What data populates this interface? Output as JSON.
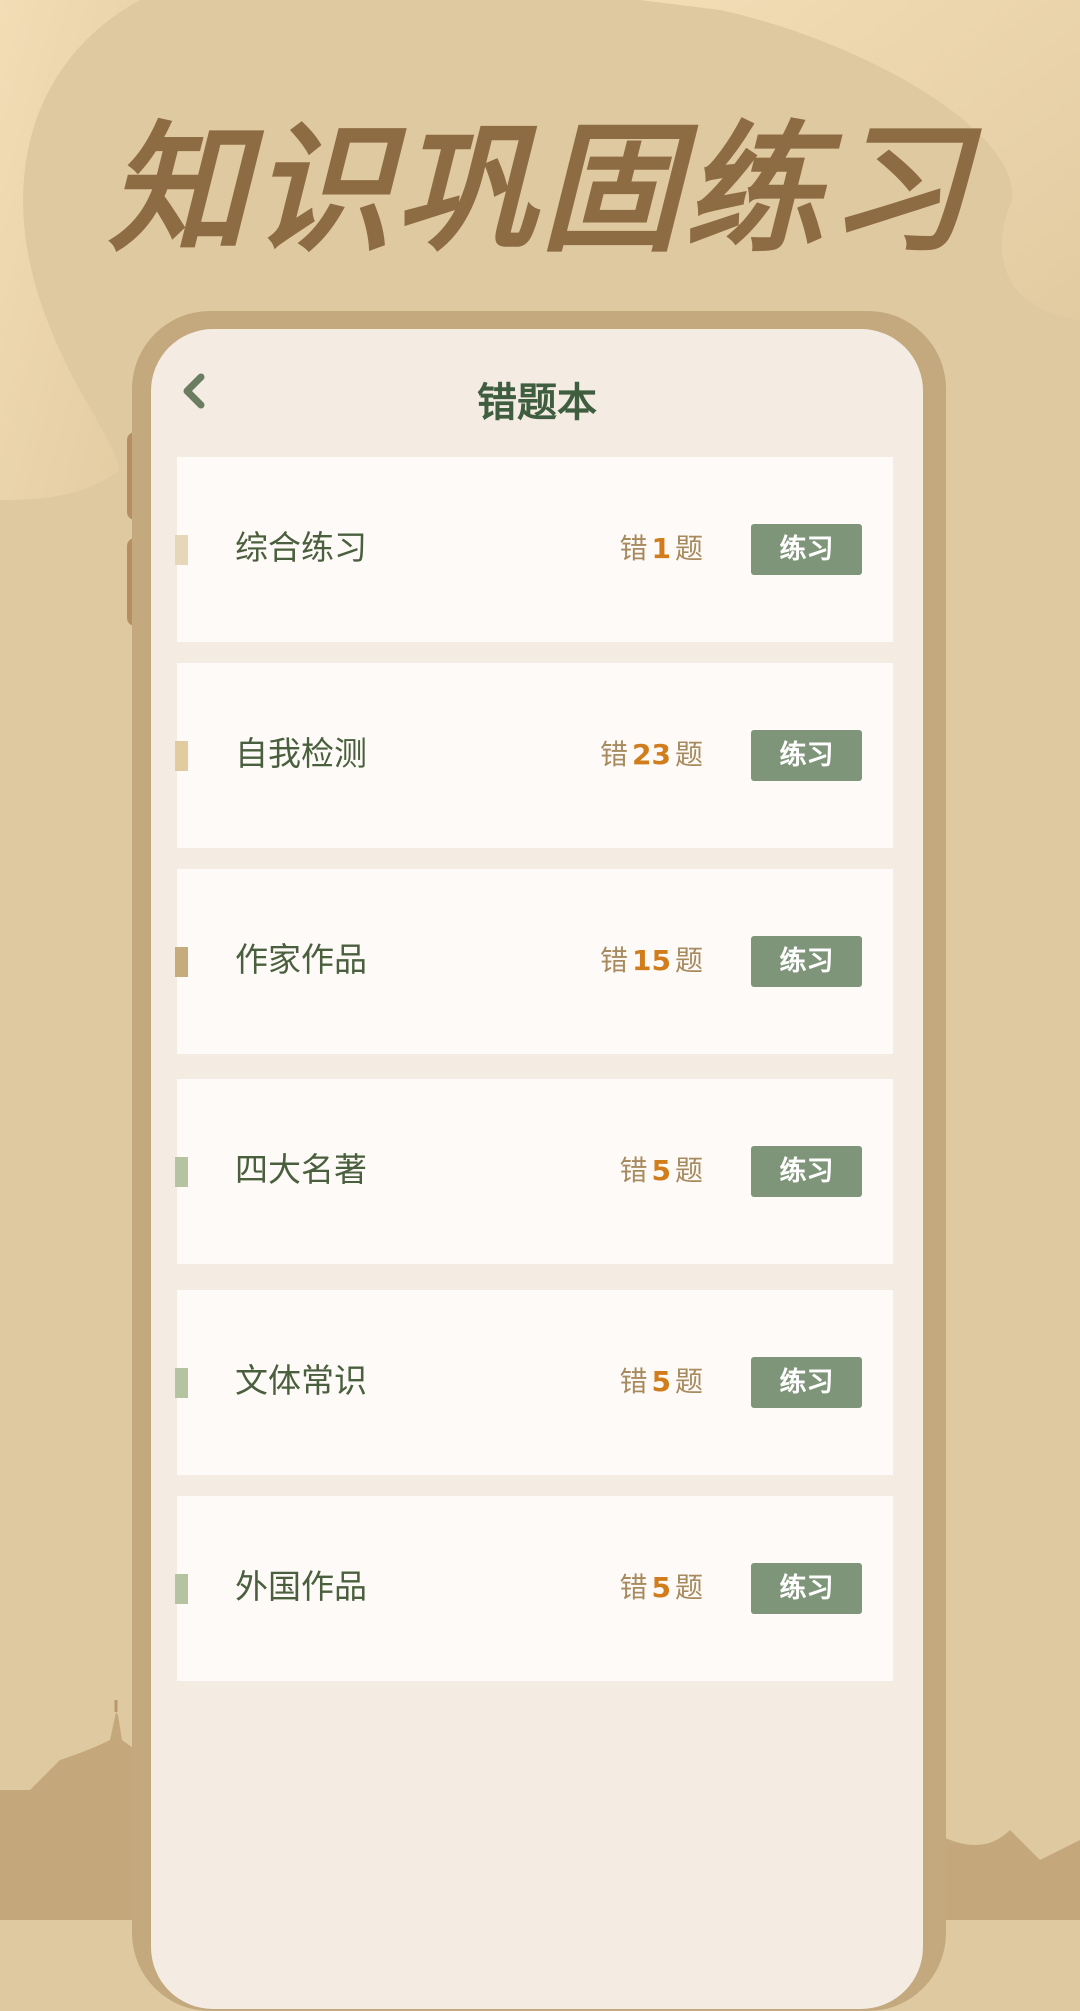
{
  "hero": {
    "title": "知识巩固练习"
  },
  "screen": {
    "title": "错题本",
    "back_icon": "chevron-left-icon"
  },
  "list": [
    {
      "name": "综合练习",
      "prefix": "错",
      "count": "1",
      "suffix": "题",
      "button": "练习",
      "accent": "#e6d7b8"
    },
    {
      "name": "自我检测",
      "prefix": "错",
      "count": "23",
      "suffix": "题",
      "button": "练习",
      "accent": "#e0cc9f"
    },
    {
      "name": "作家作品",
      "prefix": "错",
      "count": "15",
      "suffix": "题",
      "button": "练习",
      "accent": "#c6ab7d"
    },
    {
      "name": "四大名著",
      "prefix": "错",
      "count": "5",
      "suffix": "题",
      "button": "练习",
      "accent": "#b4c4a0"
    },
    {
      "name": "文体常识",
      "prefix": "错",
      "count": "5",
      "suffix": "题",
      "button": "练习",
      "accent": "#b4c4a0"
    },
    {
      "name": "外国作品",
      "prefix": "错",
      "count": "5",
      "suffix": "题",
      "button": "练习",
      "accent": "#b4c4a0"
    }
  ],
  "colors": {
    "background": "#dfc9a0",
    "title": "#8e6c43",
    "button": "#7f957a",
    "count_number": "#d17d1c",
    "heading": "#3f5e3f"
  }
}
